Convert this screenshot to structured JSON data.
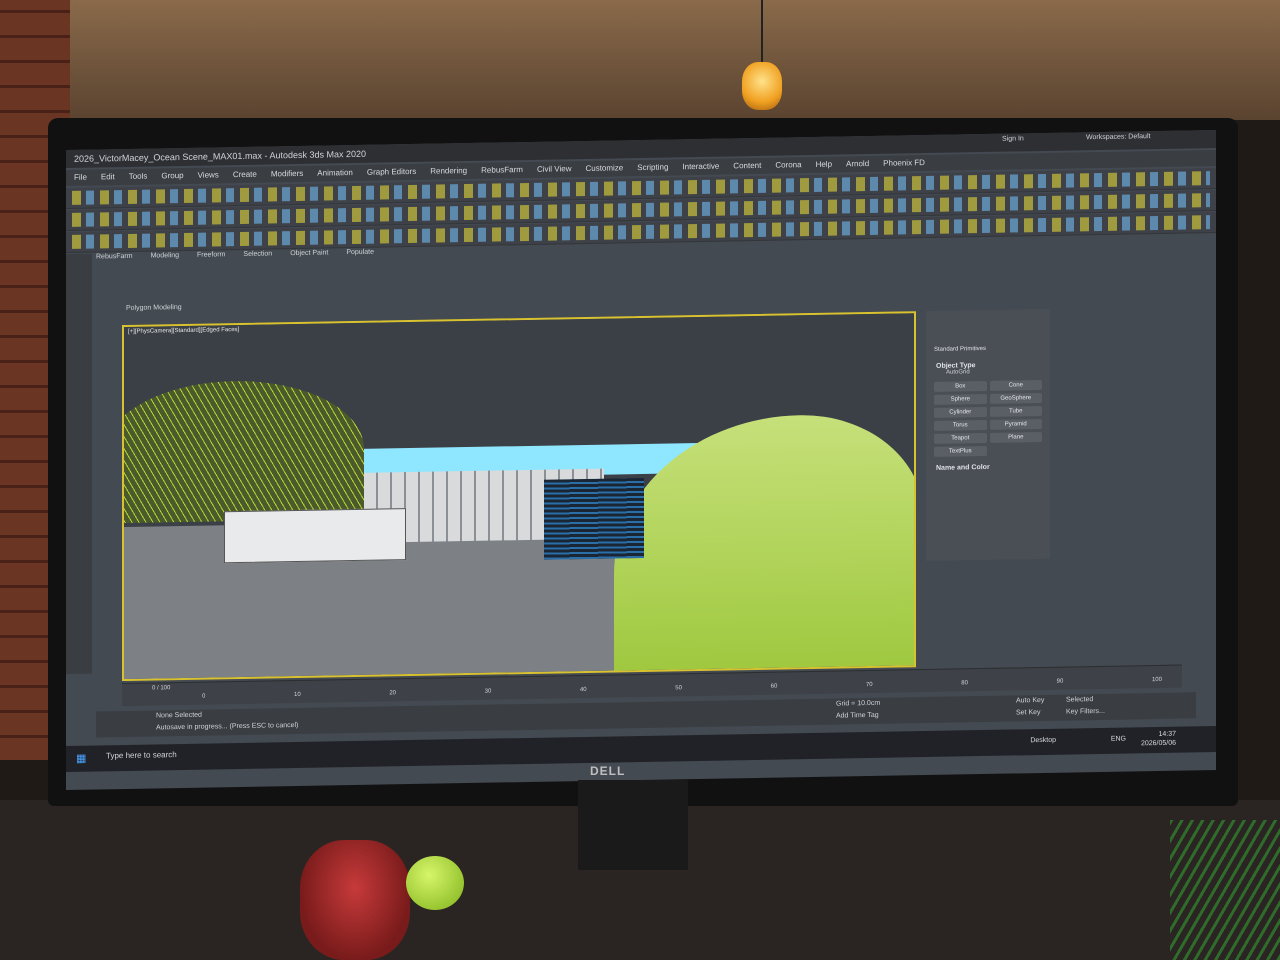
{
  "window": {
    "title": "2026_VictorMacey_Ocean Scene_MAX01.max - Autodesk 3ds Max 2020"
  },
  "menu": [
    "File",
    "Edit",
    "Tools",
    "Group",
    "Views",
    "Create",
    "Modifiers",
    "Animation",
    "Graph Editors",
    "Rendering",
    "RebusFarm",
    "Civil View",
    "Customize",
    "Scripting",
    "Interactive",
    "Content",
    "Corona",
    "Help",
    "Arnold",
    "Phoenix FD"
  ],
  "ribbon_tabs": [
    "RebusFarm",
    "Modeling",
    "Freeform",
    "Selection",
    "Object Paint",
    "Populate"
  ],
  "ribbon_panel_label": "Polygon Modeling",
  "viewport": {
    "label": "[+][PhysCamera][Standard][Edged Faces]"
  },
  "command_panel": {
    "dropdown": "Standard Primitives",
    "object_type_heading": "Object Type",
    "autogrid": "AutoGrid",
    "primitives": [
      "Box",
      "Cone",
      "Sphere",
      "GeoSphere",
      "Cylinder",
      "Tube",
      "Torus",
      "Pyramid",
      "Teapot",
      "Plane",
      "TextPlus"
    ],
    "name_color_heading": "Name and Color"
  },
  "timeline": {
    "frame": "0 / 100",
    "ticks": [
      "0",
      "10",
      "20",
      "30",
      "40",
      "50",
      "60",
      "70",
      "80",
      "90",
      "100"
    ]
  },
  "status": {
    "selection": "None Selected",
    "prompt": "Autosave in progress... (Press ESC to cancel)",
    "grid": "Grid = 10.0cm",
    "add_time_tag": "Add Time Tag",
    "auto_key": "Auto Key",
    "selected": "Selected",
    "set_key": "Set Key",
    "key_filters": "Key Filters..."
  },
  "taskbar": {
    "search_placeholder": "Type here to search",
    "desktop_label": "Desktop",
    "language": "ENG",
    "time": "14:37",
    "date": "2026/05/06"
  },
  "monitor_brand": "DELL",
  "sign_in": "Sign In",
  "workspaces": "Workspaces: Default"
}
